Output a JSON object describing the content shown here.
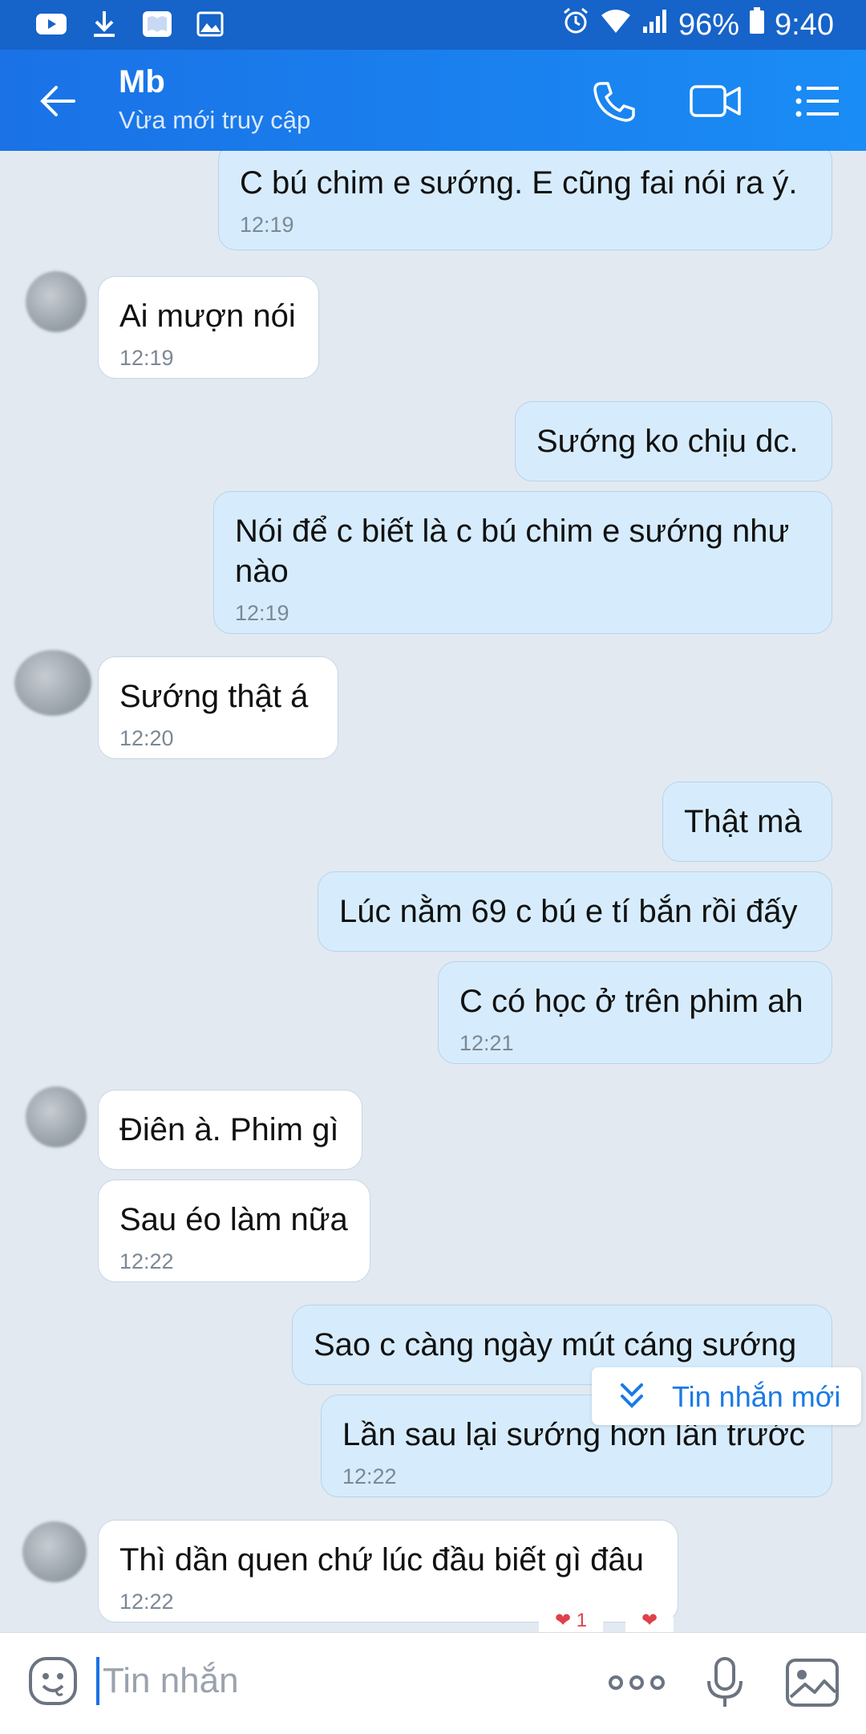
{
  "status_bar": {
    "battery": "96%",
    "time": "9:40",
    "left_icons": [
      "youtube-icon",
      "download-icon",
      "book-icon",
      "gallery-icon"
    ]
  },
  "header": {
    "title": "Mb",
    "subtitle": "Vừa mới truy cập"
  },
  "messages": [
    {
      "dir": "out",
      "text": "C bú chim e sướng. E cũng fai nói ra ý.",
      "time": "12:19"
    },
    {
      "dir": "in",
      "text": "Ai mượn nói",
      "time": "12:19"
    },
    {
      "dir": "out",
      "text": "Sướng ko chịu dc.",
      "time": ""
    },
    {
      "dir": "out",
      "text": "Nói để c biết là c bú chim e sướng như nào",
      "time": "12:19"
    },
    {
      "dir": "in",
      "text": "Sướng  thật á",
      "time": "12:20"
    },
    {
      "dir": "out",
      "text": "Thật mà",
      "time": ""
    },
    {
      "dir": "out",
      "text": "Lúc nằm 69 c bú e tí bắn rồi đấy",
      "time": ""
    },
    {
      "dir": "out",
      "text": "C có học ở trên phim ah",
      "time": "12:21"
    },
    {
      "dir": "in",
      "text": "Điên à. Phim gì",
      "time": ""
    },
    {
      "dir": "in",
      "text": "Sau éo làm nữa",
      "time": "12:22"
    },
    {
      "dir": "out",
      "text": "Sao c càng ngày mút cáng sướng",
      "time": ""
    },
    {
      "dir": "out",
      "text": "Lần sau lại sướng hơn lần trước",
      "time": "12:22"
    },
    {
      "dir": "in",
      "text": "Thì dần quen chứ lúc đầu biết gì đâu",
      "time": "12:22"
    }
  ],
  "new_message_banner": "Tin nhắn mới",
  "reactions": [
    "❤ 1",
    "❤"
  ],
  "input": {
    "placeholder": "Tin nhắn"
  },
  "colors": {
    "header": "#1a7ae6",
    "status_bar": "#1663c9",
    "outgoing_bubble": "#d6ecfc",
    "incoming_bubble": "#ffffff",
    "chat_background": "#e2e9f1"
  }
}
